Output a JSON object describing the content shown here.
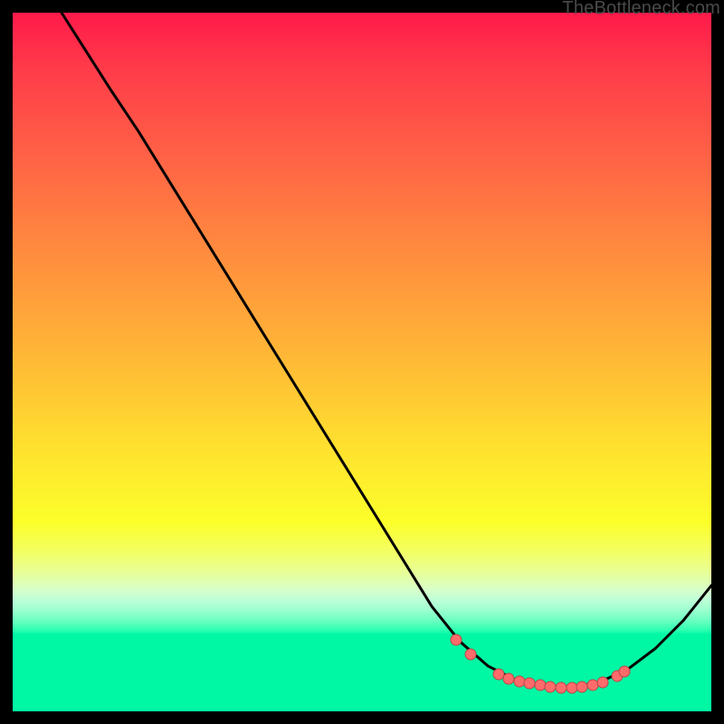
{
  "attribution": "TheBottleneck.com",
  "chart_data": {
    "type": "line",
    "title": "",
    "xlabel": "",
    "ylabel": "",
    "xlim": [
      0,
      100
    ],
    "ylim": [
      0,
      100
    ],
    "curve": [
      {
        "x": 7,
        "y": 100
      },
      {
        "x": 14,
        "y": 89
      },
      {
        "x": 18,
        "y": 83
      },
      {
        "x": 60,
        "y": 15
      },
      {
        "x": 64,
        "y": 10
      },
      {
        "x": 68,
        "y": 6.5
      },
      {
        "x": 72,
        "y": 4.5
      },
      {
        "x": 76,
        "y": 3.5
      },
      {
        "x": 80,
        "y": 3.4
      },
      {
        "x": 84,
        "y": 4.2
      },
      {
        "x": 88,
        "y": 6
      },
      {
        "x": 92,
        "y": 9
      },
      {
        "x": 96,
        "y": 13
      },
      {
        "x": 100,
        "y": 18
      }
    ],
    "marker_points": [
      {
        "x": 63.5,
        "y": 10.2
      },
      {
        "x": 65.5,
        "y": 8.2
      },
      {
        "x": 69.5,
        "y": 5.3
      },
      {
        "x": 71.0,
        "y": 4.7
      },
      {
        "x": 72.5,
        "y": 4.3
      },
      {
        "x": 74.0,
        "y": 4.0
      },
      {
        "x": 75.5,
        "y": 3.7
      },
      {
        "x": 77.0,
        "y": 3.5
      },
      {
        "x": 78.5,
        "y": 3.4
      },
      {
        "x": 80.0,
        "y": 3.4
      },
      {
        "x": 81.5,
        "y": 3.5
      },
      {
        "x": 83.0,
        "y": 3.8
      },
      {
        "x": 84.5,
        "y": 4.1
      },
      {
        "x": 86.5,
        "y": 5.0
      },
      {
        "x": 87.5,
        "y": 5.7
      }
    ],
    "gradient_stops": [
      {
        "pos": 0,
        "color": "#ff1a4a"
      },
      {
        "pos": 35,
        "color": "#ff883f"
      },
      {
        "pos": 65,
        "color": "#ffe02f"
      },
      {
        "pos": 88,
        "color": "#2cffb0"
      },
      {
        "pos": 100,
        "color": "#00f7a4"
      }
    ]
  }
}
